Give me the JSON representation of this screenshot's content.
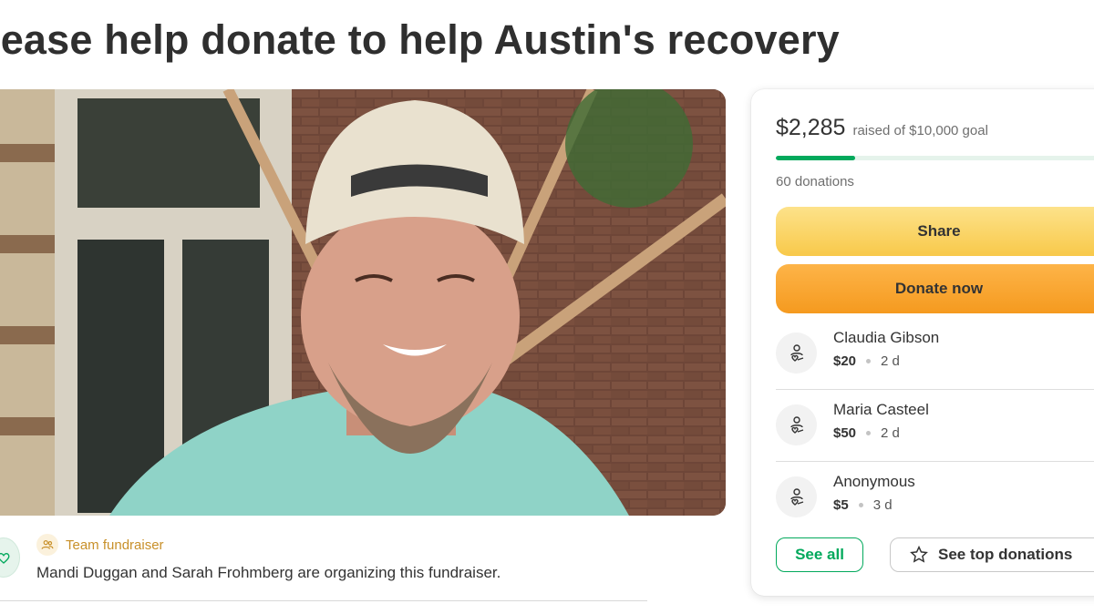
{
  "page": {
    "title": "lease help donate to help Austin's recovery"
  },
  "organizer": {
    "team_label": "Team fundraiser",
    "description": "Mandi Duggan and Sarah Frohmberg are organizing this fundraiser."
  },
  "donation_card": {
    "raised_amount": "$2,285",
    "goal_text": "raised of $10,000 goal",
    "progress_fraction": 0.2285,
    "donation_count": "60 donations",
    "share_label": "Share",
    "donate_label": "Donate now",
    "donors": [
      {
        "name": "Claudia Gibson",
        "amount": "$20",
        "time": "2 d"
      },
      {
        "name": "Maria Casteel",
        "amount": "$50",
        "time": "2 d"
      },
      {
        "name": "Anonymous",
        "amount": "$5",
        "time": "3 d"
      }
    ],
    "see_all_label": "See all",
    "see_top_label": "See top donations"
  },
  "colors": {
    "brand_green": "#02a95c",
    "share_yellow": "#f8c94a",
    "donate_orange": "#f59a1f",
    "team_gold": "#c8902a"
  },
  "icons": {
    "donor_avatar": "heart-hand-icon",
    "team": "team-icon",
    "organizer_avatar": "heart-hand-icon",
    "top_donations": "star-icon"
  }
}
